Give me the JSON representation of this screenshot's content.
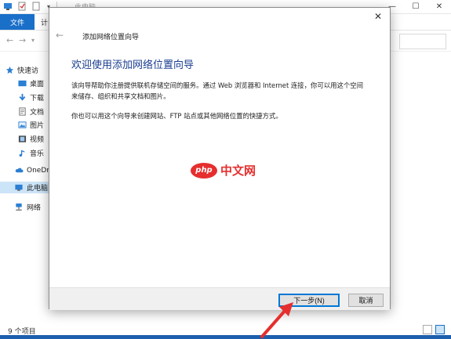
{
  "explorer": {
    "title": "此电脑",
    "ribbon": {
      "file_tab": "文件",
      "compute_tab": "计"
    },
    "sidebar": {
      "items": [
        {
          "label": "快速访",
          "icon": "star-icon"
        },
        {
          "label": "桌面",
          "icon": "desktop-icon"
        },
        {
          "label": "下载",
          "icon": "download-icon"
        },
        {
          "label": "文档",
          "icon": "document-icon"
        },
        {
          "label": "图片",
          "icon": "picture-icon"
        },
        {
          "label": "视频",
          "icon": "video-icon"
        },
        {
          "label": "音乐",
          "icon": "music-icon"
        },
        {
          "label": "OneDri",
          "icon": "cloud-icon"
        },
        {
          "label": "此电脑",
          "icon": "computer-icon"
        },
        {
          "label": "网络",
          "icon": "network-icon"
        }
      ]
    },
    "status": {
      "item_count": "9 个项目"
    },
    "colors": {
      "accent": "#1a6fc9",
      "selected": "#cce4f7",
      "taskbar": "#1c5fae"
    }
  },
  "wizard": {
    "title": "添加网络位置向导",
    "heading": "欢迎使用添加网络位置向导",
    "paragraph1": "该向导帮助你注册提供联机存储空间的服务。通过 Web 浏览器和 Internet 连接，你可以用这个空间来储存、组织和共享文档和图片。",
    "paragraph2": "你也可以用这个向导来创建网站、FTP 站点或其他网络位置的快捷方式。",
    "buttons": {
      "next": "下一步(N)",
      "cancel": "取消"
    },
    "colors": {
      "heading": "#1a3d8f",
      "focus": "#0078d7"
    }
  },
  "watermark": {
    "badge": "php",
    "text": "中文网",
    "color": "#e62e2e"
  }
}
